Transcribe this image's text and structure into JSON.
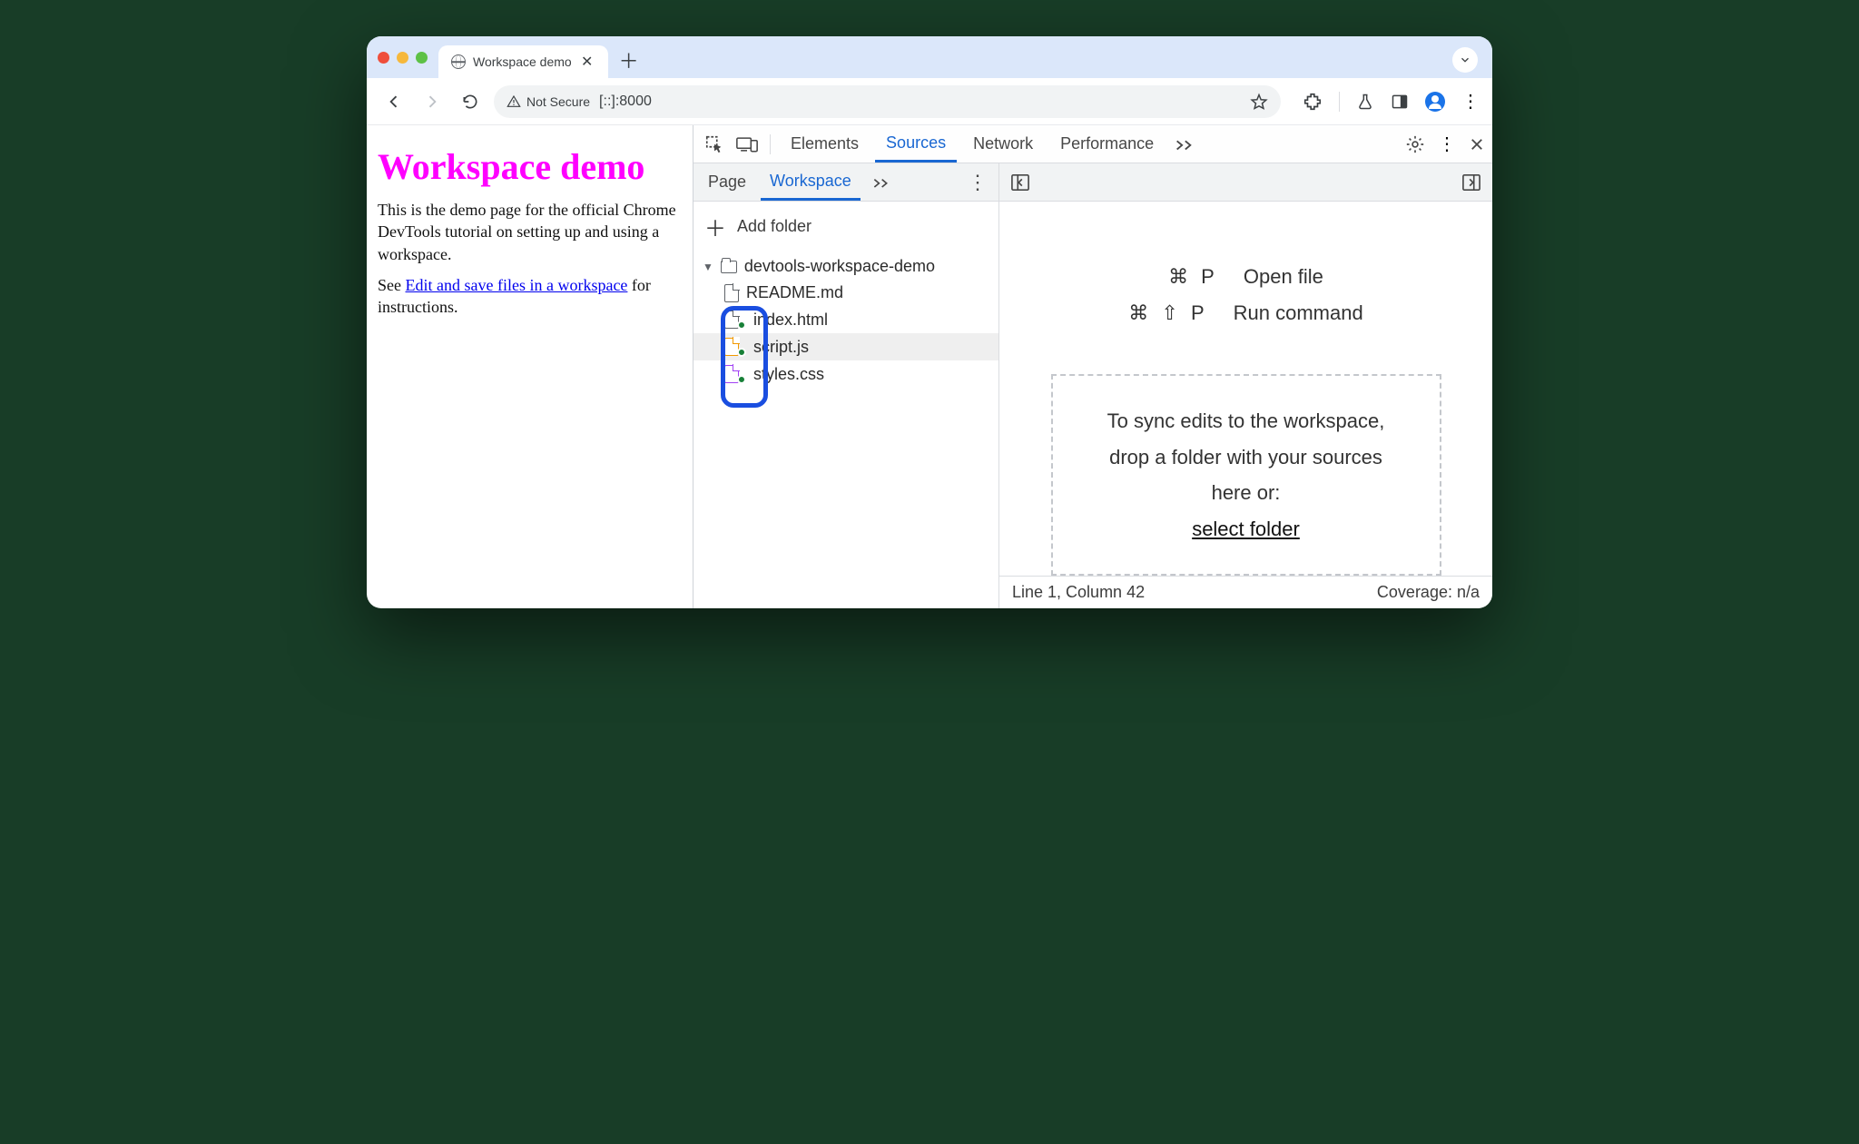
{
  "browser": {
    "tab_title": "Workspace demo",
    "toolbar": {
      "security_label": "Not Secure",
      "url": "[::]:8000"
    }
  },
  "page": {
    "heading": "Workspace demo",
    "para1": "This is the demo page for the official Chrome DevTools tutorial on setting up and using a workspace.",
    "para2_pre": "See ",
    "link": "Edit and save files in a workspace",
    "para2_post": " for instructions."
  },
  "devtools": {
    "tabs": {
      "elements": "Elements",
      "sources": "Sources",
      "network": "Network",
      "performance": "Performance"
    },
    "nav_tabs": {
      "page": "Page",
      "workspace": "Workspace"
    },
    "add_folder": "Add folder",
    "tree": {
      "root": "devtools-workspace-demo",
      "files": {
        "readme": "README.md",
        "index": "index.html",
        "script": "script.js",
        "styles": "styles.css"
      }
    },
    "hints": {
      "open_file_kbd": "⌘ P",
      "open_file": "Open file",
      "run_cmd_kbd": "⌘ ⇧ P",
      "run_cmd": "Run command"
    },
    "drop": {
      "text": "To sync edits to the workspace, drop a folder with your sources here or:",
      "select": "select folder"
    },
    "status": {
      "pos": "Line 1, Column 42",
      "coverage": "Coverage: n/a"
    }
  }
}
